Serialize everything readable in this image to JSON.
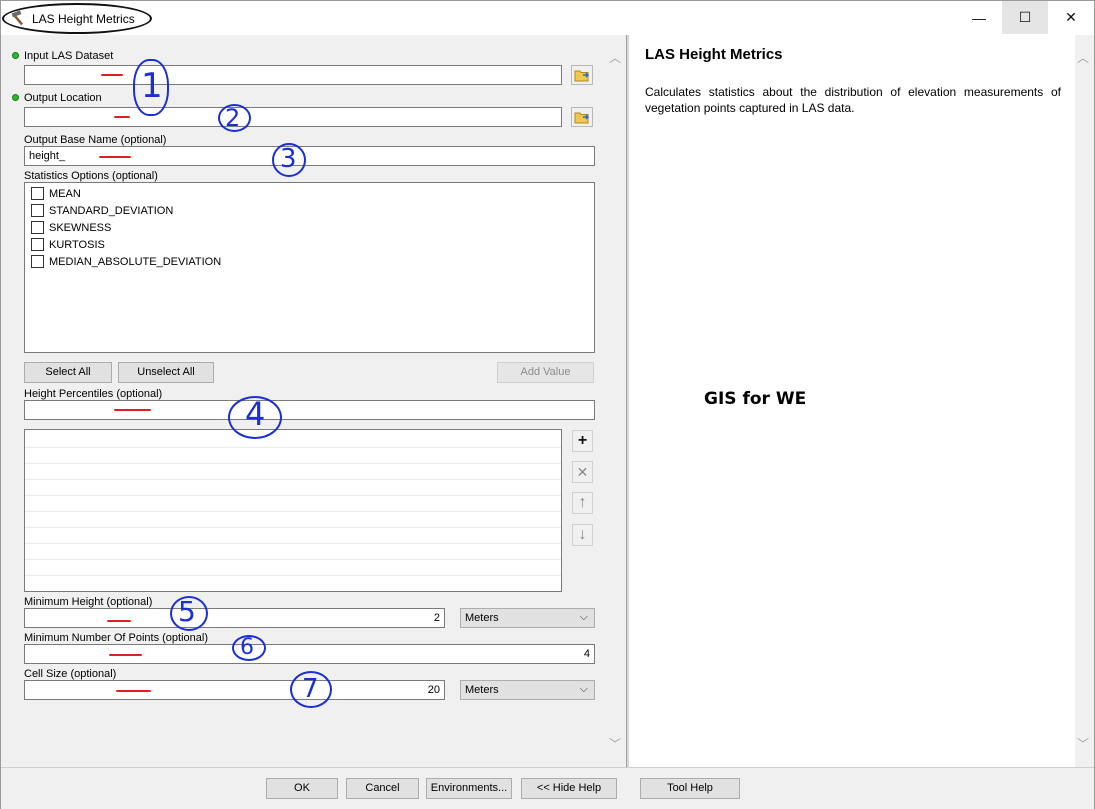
{
  "window": {
    "title": "LAS Height Metrics",
    "controls": {
      "minimize": "—",
      "maximize": "☐",
      "close": "✕"
    }
  },
  "params": {
    "input_las": {
      "label": "Input LAS Dataset",
      "value": ""
    },
    "output_location": {
      "label": "Output Location",
      "value": ""
    },
    "output_base_name": {
      "label": "Output Base Name (optional)",
      "value": "height_"
    },
    "statistics_options": {
      "label": "Statistics Options (optional)",
      "items": [
        "MEAN",
        "STANDARD_DEVIATION",
        "SKEWNESS",
        "KURTOSIS",
        "MEDIAN_ABSOLUTE_DEVIATION"
      ]
    },
    "buttons": {
      "select_all": "Select All",
      "unselect_all": "Unselect All",
      "add_value": "Add Value"
    },
    "height_percentiles": {
      "label": "Height Percentiles (optional)",
      "value": ""
    },
    "minimum_height": {
      "label": "Minimum Height (optional)",
      "value": "2",
      "unit": "Meters"
    },
    "minimum_points": {
      "label": "Minimum Number Of Points (optional)",
      "value": "4"
    },
    "cell_size": {
      "label": "Cell Size (optional)",
      "value": "20",
      "unit": "Meters"
    }
  },
  "help": {
    "title": "LAS Height Metrics",
    "description": "Calculates statistics about the distribution of elevation measurements of vegetation points captured in LAS data.",
    "watermark": "GIS for WE"
  },
  "footer": {
    "ok": "OK",
    "cancel": "Cancel",
    "environments": "Environments...",
    "hide_help": "<< Hide Help",
    "tool_help": "Tool Help"
  },
  "annotations": [
    "1",
    "2",
    "3",
    "4",
    "5",
    "6",
    "7"
  ],
  "colors": {
    "annotation_blue": "#1a2fd4",
    "annotation_red": "#e02020",
    "required_dot": "#2eb82e"
  }
}
